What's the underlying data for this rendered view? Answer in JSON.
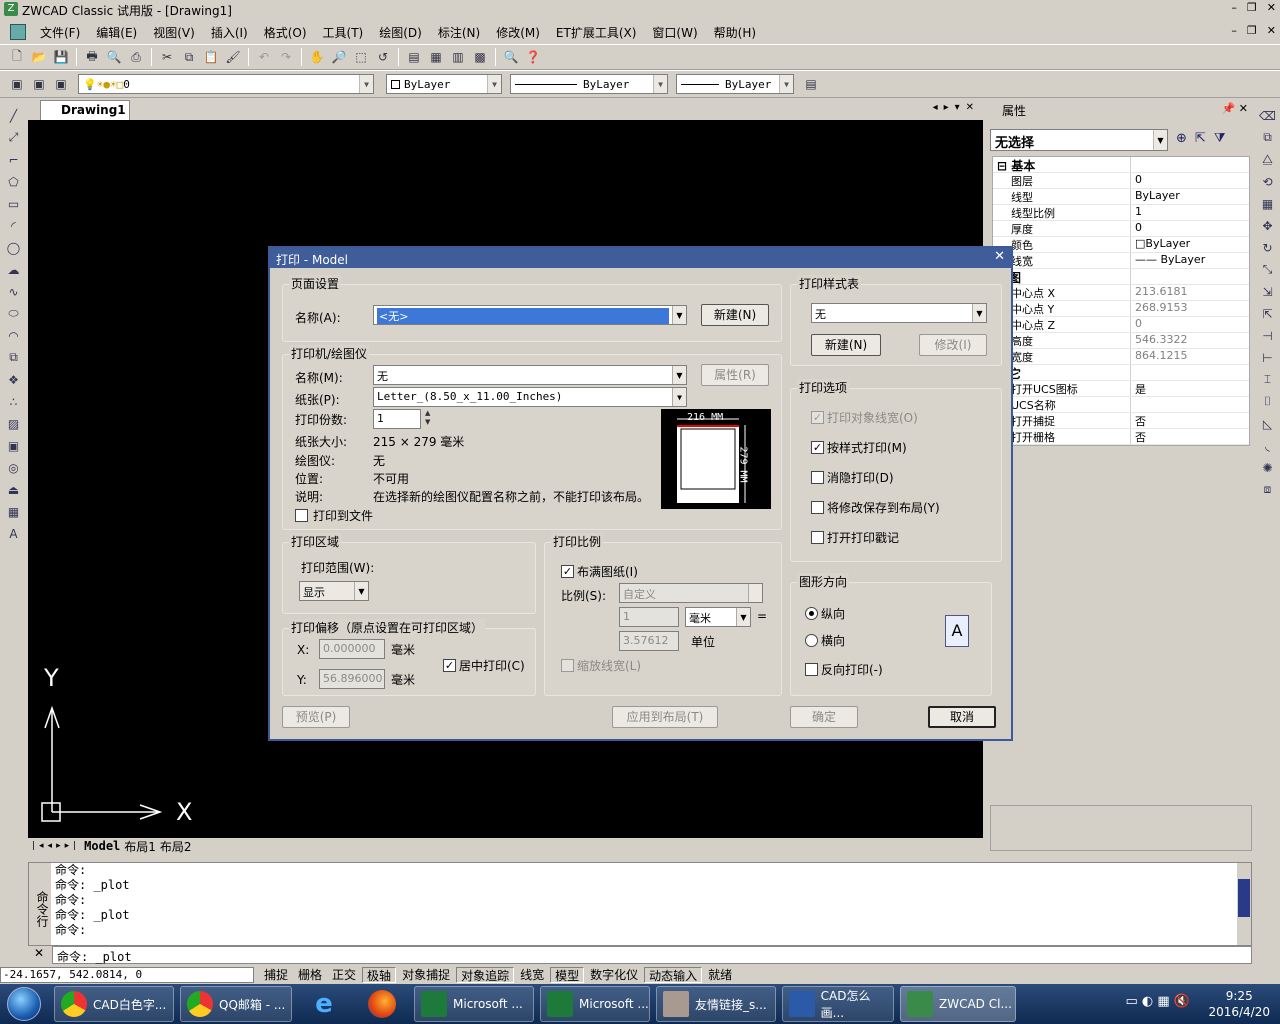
{
  "window": {
    "title": "ZWCAD Classic 试用版 - [Drawing1]"
  },
  "menu": [
    "文件(F)",
    "编辑(E)",
    "视图(V)",
    "插入(I)",
    "格式(O)",
    "工具(T)",
    "绘图(D)",
    "标注(N)",
    "修改(M)",
    "ET扩展工具(X)",
    "窗口(W)",
    "帮助(H)"
  ],
  "layers": {
    "current_layer": "0",
    "color": "ByLayer",
    "linetype": "ByLayer",
    "lineweight": "ByLayer"
  },
  "doc_tab": "Drawing1",
  "layout_tabs": [
    "Model",
    "布局1",
    "布局2"
  ],
  "ucs": {
    "y_label": "Y",
    "x_label": "X"
  },
  "properties": {
    "title": "属性",
    "selection": "无选择",
    "rows": [
      {
        "key": "基本",
        "value": "",
        "cat": true
      },
      {
        "key": "图层",
        "value": "0"
      },
      {
        "key": "线型",
        "value": "ByLayer"
      },
      {
        "key": "线型比例",
        "value": "1"
      },
      {
        "key": "厚度",
        "value": "0"
      },
      {
        "key": "颜色",
        "value": "□ByLayer"
      },
      {
        "key": "线宽",
        "value": "—— ByLayer"
      },
      {
        "key": "视图",
        "value": "",
        "cat": true
      },
      {
        "key": "中心点 X",
        "value": "213.6181",
        "gray": true
      },
      {
        "key": "中心点 Y",
        "value": "268.9153",
        "gray": true
      },
      {
        "key": "中心点 Z",
        "value": "0",
        "gray": true
      },
      {
        "key": "高度",
        "value": "546.3322",
        "gray": true
      },
      {
        "key": "宽度",
        "value": "864.1215",
        "gray": true
      },
      {
        "key": "其它",
        "value": "",
        "cat": true
      },
      {
        "key": "打开UCS图标",
        "value": "是"
      },
      {
        "key": "UCS名称",
        "value": ""
      },
      {
        "key": "打开捕捉",
        "value": "否"
      },
      {
        "key": "打开栅格",
        "value": "否"
      }
    ]
  },
  "dialog": {
    "title": "打印 - Model",
    "page_setup": {
      "group": "页面设置",
      "name_label": "名称(A):",
      "name_value": "<无>",
      "new_btn": "新建(N)"
    },
    "printer": {
      "group": "打印机/绘图仪",
      "name_label": "名称(M):",
      "name_value": "无",
      "props_btn": "属性(R)",
      "paper_label": "纸张(P):",
      "paper_value": "Letter_(8.50_x_11.00_Inches)",
      "copies_label": "打印份数:",
      "copies_value": "1",
      "size_label": "纸张大小:",
      "size_value": "215 × 279  毫米",
      "plotter_label": "绘图仪:",
      "plotter_value": "无",
      "location_label": "位置:",
      "location_value": "不可用",
      "desc_label": "说明:",
      "desc_value": "在选择新的绘图仪配置名称之前，不能打印该布局。",
      "to_file": "打印到文件",
      "preview_w": "216 MM",
      "preview_h": "279 MM"
    },
    "area": {
      "group": "打印区域",
      "range_label": "打印范围(W):",
      "range_value": "显示"
    },
    "offset": {
      "group": "打印偏移（原点设置在可打印区域）",
      "x_label": "X:",
      "x_value": "0.000000",
      "y_label": "Y:",
      "y_value": "56.896000",
      "unit": "毫米",
      "center": "居中打印(C)"
    },
    "scale": {
      "group": "打印比例",
      "fit": "布满图纸(I)",
      "scale_label": "比例(S):",
      "scale_value": "自定义",
      "v1": "1",
      "unit_value": "毫米",
      "eq": "=",
      "v2": "3.57612",
      "unit2": "单位",
      "lw": "缩放线宽(L)"
    },
    "style": {
      "group": "打印样式表",
      "value": "无",
      "new_btn": "新建(N)",
      "edit_btn": "修改(I)"
    },
    "options": {
      "group": "打印选项",
      "o1": "打印对象线宽(O)",
      "o2": "按样式打印(M)",
      "o3": "消隐打印(D)",
      "o4": "将修改保存到布局(Y)",
      "o5": "打开打印戳记"
    },
    "orient": {
      "group": "图形方向",
      "portrait": "纵向",
      "landscape": "横向",
      "reverse": "反向打印(-)",
      "icon_letter": "A"
    },
    "buttons": {
      "preview": "预览(P)",
      "apply": "应用到布局(T)",
      "ok": "确定",
      "cancel": "取消"
    }
  },
  "command": {
    "side": "命令行",
    "lines": [
      "命令:",
      "命令: _plot",
      "命令:",
      "命令: _plot",
      "命令:"
    ],
    "input": "命令: _plot"
  },
  "status": {
    "coord": "-24.1657,  542.0814,  0",
    "toggles": [
      "捕捉",
      "栅格",
      "正交",
      "极轴",
      "对象捕捉",
      "对象追踪",
      "线宽",
      "模型",
      "数字化仪",
      "动态输入",
      "就绪"
    ],
    "on": [
      3,
      5,
      7,
      9
    ]
  },
  "taskbar": {
    "tasks": [
      "CAD白色字...",
      "QQ邮箱 - ...",
      "Microsoft ...",
      "Microsoft ...",
      "友情链接_s...",
      "CAD怎么画...",
      "ZWCAD Cl..."
    ],
    "time": "9:25",
    "date": "2016/4/20"
  }
}
